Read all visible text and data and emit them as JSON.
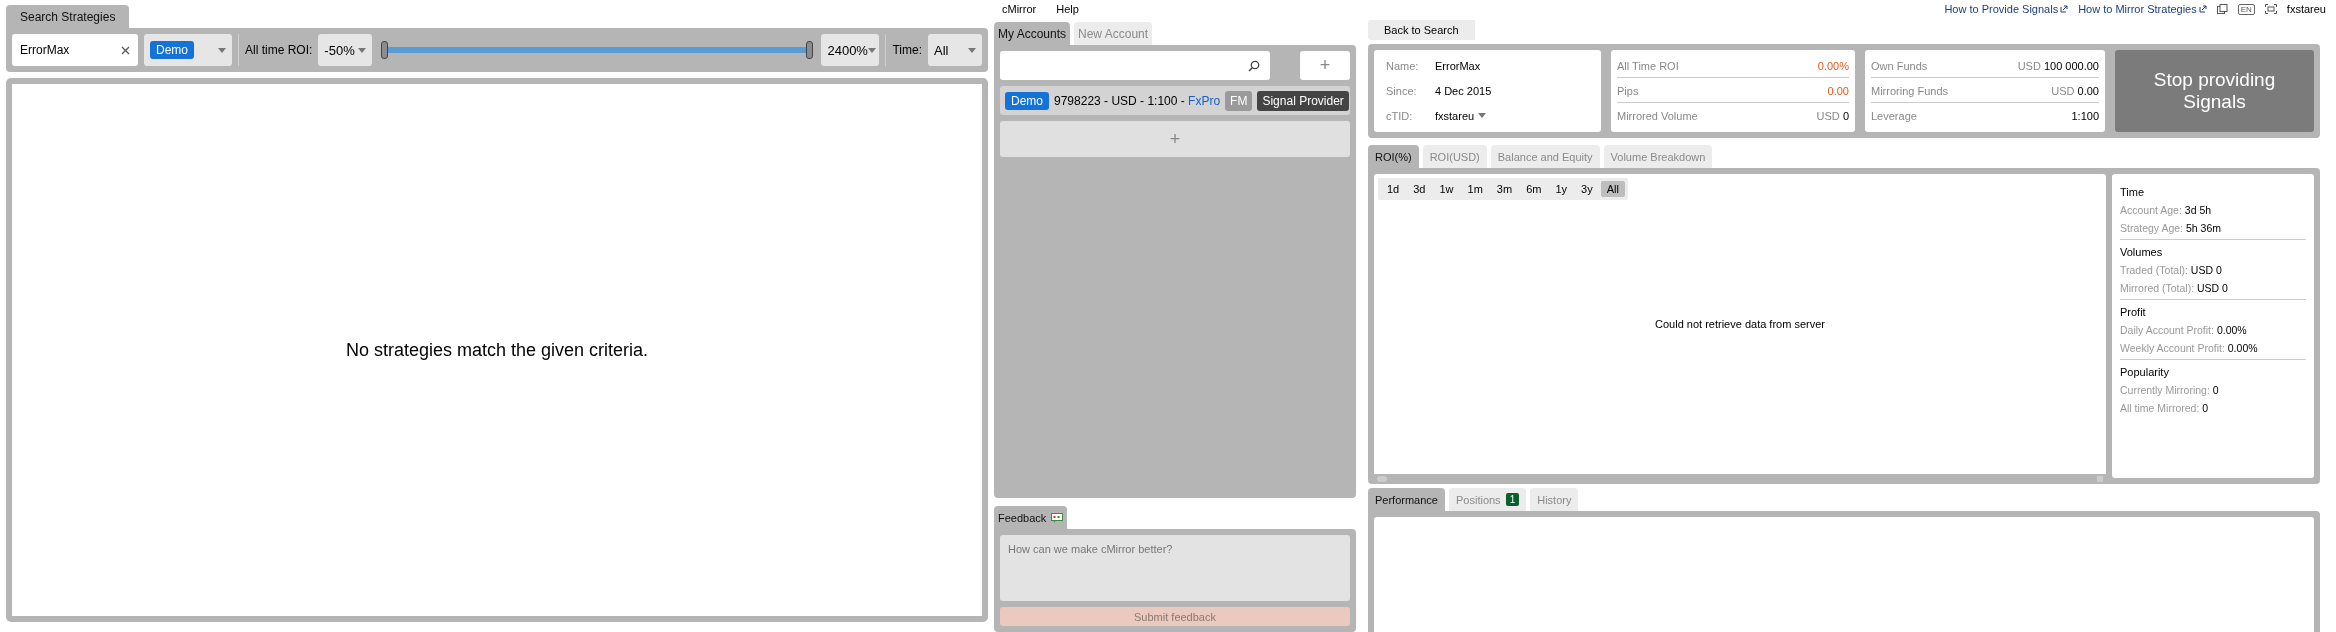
{
  "search": {
    "tab": "Search Strategies",
    "query": "ErrorMax",
    "account_type": "Demo",
    "roi_label": "All time ROI:",
    "roi_min": "-50%",
    "roi_max": "2400%",
    "min_thumb": {
      "level": 0
    },
    "max_thumb": {
      "level": 1
    },
    "time_label": "Time:",
    "time": "All",
    "empty_message": "No strategies match the given criteria."
  },
  "menu": [
    "cMirror",
    "Help"
  ],
  "accounts": {
    "tabs": [
      {
        "label": "My Accounts",
        "selected": true
      },
      {
        "label": "New Account",
        "selected": false
      }
    ],
    "rows": [
      {
        "badge": "Demo",
        "text": "9798223 - USD - 1:100 - ",
        "broker": "FxPro",
        "tags": [
          {
            "label": "FM",
            "kind": "muted"
          },
          {
            "label": "Signal Provider",
            "kind": "dark"
          }
        ]
      }
    ],
    "add": "+",
    "new": "+"
  },
  "feedback": {
    "tab": "Feedback",
    "placeholder": "How can we make cMirror better?",
    "submit": "Submit feedback"
  },
  "header": {
    "links": [
      "How to Provide Signals",
      "How to Mirror Strategies"
    ],
    "lang": "EN",
    "user": "fxstareu"
  },
  "back": "Back to Search",
  "profile": [
    {
      "label": "Name:",
      "value": "ErrorMax",
      "kind": "text"
    },
    {
      "label": "Since:",
      "value": "4 Dec 2015",
      "kind": "text"
    },
    {
      "label": "cTID:",
      "value": "fxstareu",
      "kind": "dropdown"
    }
  ],
  "stats": [
    {
      "label": "All Time ROI",
      "value": "0.00%",
      "kind": "accent"
    },
    {
      "label": "Pips",
      "value": "0.00",
      "kind": "accent"
    },
    {
      "label": "Mirrored Volume",
      "unit": "USD",
      "value": "0",
      "kind": "plain"
    }
  ],
  "funds": [
    {
      "label": "Own Funds",
      "unit": "USD",
      "value": "100 000.00",
      "kind": "plain"
    },
    {
      "label": "Mirroring Funds",
      "unit": "USD",
      "value": "0.00",
      "kind": "plain"
    },
    {
      "label": "Leverage",
      "value": "1:100",
      "kind": "plain"
    }
  ],
  "action_button": "Stop providing Signals",
  "chart_tabs": [
    {
      "label": "ROI(%)",
      "selected": true
    },
    {
      "label": "ROI(USD)",
      "selected": false
    },
    {
      "label": "Balance and Equity",
      "selected": false
    },
    {
      "label": "Volume Breakdown",
      "selected": false
    }
  ],
  "ranges": [
    {
      "label": "1d",
      "selected": false
    },
    {
      "label": "3d",
      "selected": false
    },
    {
      "label": "1w",
      "selected": false
    },
    {
      "label": "1m",
      "selected": false
    },
    {
      "label": "3m",
      "selected": false
    },
    {
      "label": "6m",
      "selected": false
    },
    {
      "label": "1y",
      "selected": false
    },
    {
      "label": "3y",
      "selected": false
    },
    {
      "label": "All",
      "selected": true
    }
  ],
  "chart_message": "Could not retrieve data from server",
  "summary": [
    {
      "title": "Time",
      "rows": [
        {
          "label": "Account Age:",
          "value": "3d 5h"
        },
        {
          "label": "Strategy Age:",
          "value": "5h 36m"
        }
      ]
    },
    {
      "title": "Volumes",
      "rows": [
        {
          "label": "Traded (Total):",
          "value": "USD 0"
        },
        {
          "label": "Mirrored (Total):",
          "value": "USD 0"
        }
      ]
    },
    {
      "title": "Profit",
      "rows": [
        {
          "label": "Daily Account Profit:",
          "value": "0.00%"
        },
        {
          "label": "Weekly Account Profit:",
          "value": "0.00%"
        }
      ]
    },
    {
      "title": "Popularity",
      "rows": [
        {
          "label": "Currently Mirroring:",
          "value": "0"
        },
        {
          "label": "All time Mirrored:",
          "value": "0"
        }
      ]
    }
  ],
  "bottom_tabs": [
    {
      "label": "Performance",
      "selected": true
    },
    {
      "label": "Positions",
      "count": "1",
      "selected": false
    },
    {
      "label": "History",
      "selected": false
    }
  ]
}
